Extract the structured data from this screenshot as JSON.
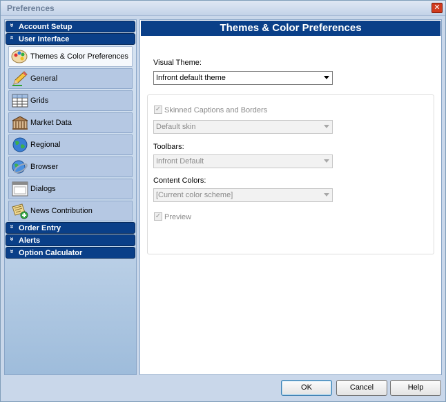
{
  "window": {
    "title": "Preferences",
    "close_symbol": "✕"
  },
  "sidebar": {
    "groups": {
      "account_setup": "Account Setup",
      "user_interface": "User Interface",
      "order_entry": "Order Entry",
      "alerts": "Alerts",
      "option_calculator": "Option Calculator"
    },
    "items": [
      {
        "label": "Themes & Color Preferences",
        "icon": "palette-icon",
        "active": true
      },
      {
        "label": "General",
        "icon": "pencil-icon"
      },
      {
        "label": "Grids",
        "icon": "grid-icon"
      },
      {
        "label": "Market Data",
        "icon": "building-icon"
      },
      {
        "label": "Regional",
        "icon": "globe-icon"
      },
      {
        "label": "Browser",
        "icon": "browser-globe-icon"
      },
      {
        "label": "Dialogs",
        "icon": "dialog-window-icon"
      },
      {
        "label": "News Contribution",
        "icon": "news-add-icon"
      }
    ],
    "chevron_symbol": "»"
  },
  "panel": {
    "title": "Themes & Color Preferences",
    "visual_theme_label": "Visual Theme:",
    "visual_theme_value": "Infront default theme",
    "skinned_label": "Skinned Captions and Borders",
    "skin_value": "Default skin",
    "toolbars_label": "Toolbars:",
    "toolbars_value": "Infront Default",
    "content_colors_label": "Content Colors:",
    "content_colors_value": "[Current color scheme]",
    "preview_label": "Preview",
    "check_symbol": "✓"
  },
  "buttons": {
    "ok": "OK",
    "cancel": "Cancel",
    "help": "Help"
  },
  "colors": {
    "header_blue": "#0a3f88",
    "sidebar_item": "#b5c8e3",
    "frame": "#c9d7ea"
  }
}
